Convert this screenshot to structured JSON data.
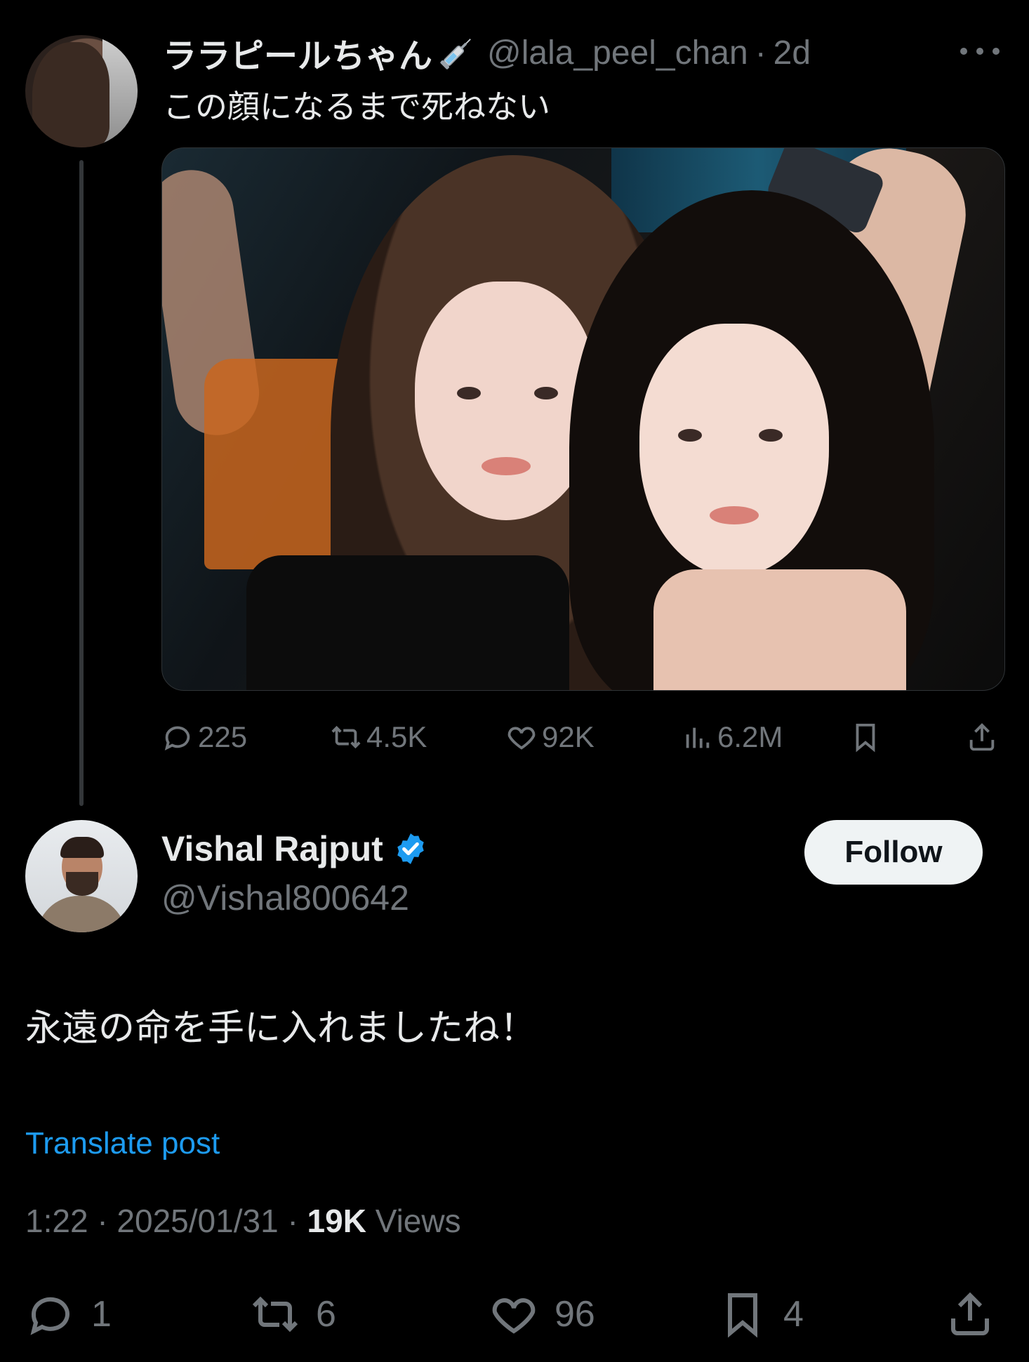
{
  "parent_post": {
    "display_name": "ララピールちゃん",
    "handle": "@lala_peel_chan",
    "separator": "·",
    "time": "2d",
    "text": "この顔になるまで死ねない",
    "stats": {
      "replies": "225",
      "reposts": "4.5K",
      "likes": "92K",
      "views": "6.2M"
    }
  },
  "reply_post": {
    "display_name": "Vishal Rajput",
    "handle": "@Vishal800642",
    "follow_label": "Follow",
    "text": "永遠の命を手に入れましたね！",
    "translate_label": "Translate post",
    "time": "1:22",
    "date": "2025/01/31",
    "separator": "·",
    "views_count": "19K",
    "views_label": "Views",
    "stats": {
      "replies": "1",
      "reposts": "6",
      "likes": "96",
      "bookmarks": "4"
    }
  },
  "colors": {
    "background": "#000000",
    "primary_text": "#e7e9ea",
    "secondary_text": "#71767b",
    "link": "#1d9bf0",
    "verified": "#1d9bf0",
    "follow_bg": "#eff3f4"
  },
  "icons": [
    "syringe-icon",
    "more-icon",
    "reply-icon",
    "repost-icon",
    "like-icon",
    "views-icon",
    "bookmark-icon",
    "share-icon",
    "verified-badge-icon"
  ]
}
